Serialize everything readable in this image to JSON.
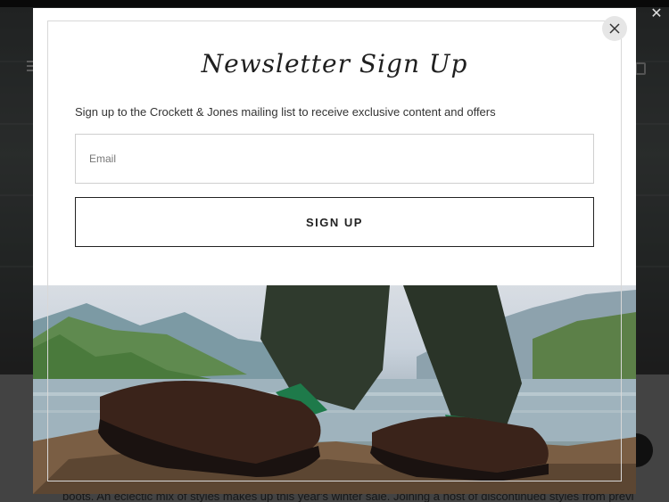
{
  "background": {
    "body_text": "boots. An eclectic mix of styles makes up this year's winter sale. Joining a host of discontinued styles from previous"
  },
  "modal": {
    "title": "Newsletter Sign Up",
    "subtitle": "Sign up to the Crockett & Jones mailing list to receive exclusive content and offers",
    "email_placeholder": "Email",
    "email_value": "",
    "signup_label": "SIGN UP",
    "close_icon": "close-icon"
  },
  "colors": {
    "overlay": "#000000",
    "modal_bg": "#ffffff",
    "button_border": "#222222",
    "close_bg": "#e6e6e6"
  }
}
